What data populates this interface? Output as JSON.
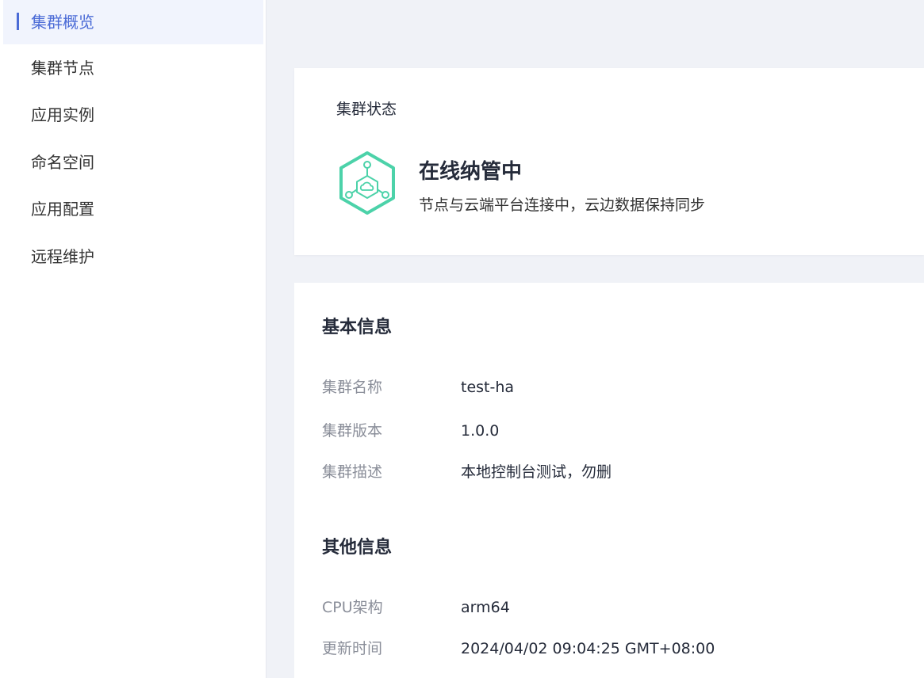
{
  "sidebar": {
    "items": [
      {
        "label": "集群概览",
        "active": true
      },
      {
        "label": "集群节点"
      },
      {
        "label": "应用实例"
      },
      {
        "label": "命名空间"
      },
      {
        "label": "应用配置"
      },
      {
        "label": "远程维护"
      }
    ]
  },
  "status": {
    "header": "集群状态",
    "title": "在线纳管中",
    "description": "节点与云端平台连接中，云边数据保持同步",
    "icon": "cloud-hub-hexagon-icon",
    "icon_color": "#4cd2a9"
  },
  "basic_info": {
    "title": "基本信息",
    "rows": [
      {
        "label": "集群名称",
        "value": "test-ha"
      },
      {
        "label": "集群版本",
        "value": "1.0.0"
      },
      {
        "label": "集群描述",
        "value": "本地控制台测试，勿删"
      }
    ]
  },
  "other_info": {
    "title": "其他信息",
    "rows": [
      {
        "label": "CPU架构",
        "value": "arm64"
      },
      {
        "label": "更新时间",
        "value": "2024/04/02 09:04:25 GMT+08:00"
      }
    ]
  },
  "colors": {
    "accent": "#4b6bd6",
    "page_bg": "#f0f2f7",
    "label": "#8a8e99",
    "text": "#252b3a"
  }
}
